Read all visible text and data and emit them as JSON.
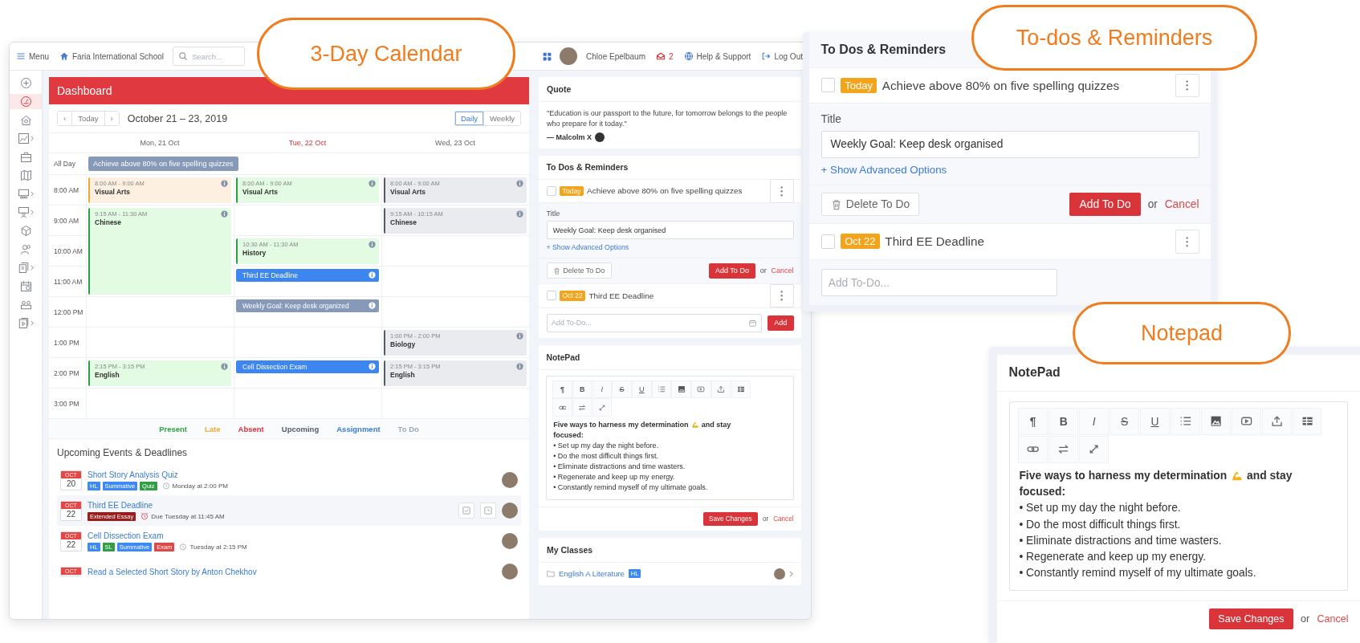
{
  "callouts": [
    {
      "label": "3-Day Calendar"
    },
    {
      "label": "To-dos & Reminders"
    },
    {
      "label": "Notepad"
    }
  ],
  "top_bar": {
    "menu": "Menu",
    "school": "Faria International School",
    "search_placeholder": "Search...",
    "user": "Chloe Epelbaum",
    "mail_count": "2",
    "help": "Help & Support",
    "logout": "Log Out"
  },
  "rail": [
    {
      "selected": false,
      "expandable": false
    },
    {
      "selected": true,
      "expandable": false
    },
    {
      "selected": false,
      "expandable": false
    },
    {
      "selected": false,
      "expandable": true
    },
    {
      "selected": false,
      "expandable": false
    },
    {
      "selected": false,
      "expandable": false
    },
    {
      "selected": false,
      "expandable": true
    },
    {
      "selected": false,
      "expandable": true
    },
    {
      "selected": false,
      "expandable": false
    },
    {
      "selected": false,
      "expandable": false
    },
    {
      "selected": false,
      "expandable": true
    },
    {
      "selected": false,
      "expandable": false
    },
    {
      "selected": false,
      "expandable": false
    },
    {
      "selected": false,
      "expandable": true
    }
  ],
  "dashboard": {
    "title": "Dashboard",
    "nav": {
      "prev": "‹",
      "today": "Today",
      "next": "›"
    },
    "range": "October 21 – 23, 2019",
    "views": [
      {
        "label": "Daily",
        "selected": true
      },
      {
        "label": "Weekly",
        "selected": false
      }
    ],
    "all_day_label": "All Day",
    "hours": [
      "8:00 AM",
      "9:00 AM",
      "10:00 AM",
      "11:00 AM",
      "12:00 PM",
      "1:00 PM",
      "2:00 PM",
      "3:00 PM"
    ],
    "days": [
      {
        "label": "Mon, 21 Oct",
        "today": false,
        "all_day": [
          {
            "title": "Achieve above 80% on five spelling quizzes"
          }
        ],
        "events": [
          {
            "time": "8:00 AM - 9:00 AM",
            "title": "Visual Arts",
            "kind": "late"
          },
          {
            "time": "9:15 AM - 11:30 AM",
            "title": "Chinese",
            "kind": "present"
          },
          {
            "time": "2:15 PM - 3:15 PM",
            "title": "English",
            "kind": "present"
          }
        ]
      },
      {
        "label": "Tue, 22 Oct",
        "today": true,
        "events": [
          {
            "time": "8:00 AM - 9:00 AM",
            "title": "Visual Arts",
            "kind": "present"
          },
          {
            "time": "10:30 AM - 11:30 AM",
            "title": "History",
            "kind": "present"
          },
          {
            "title": "Third EE Deadline",
            "kind": "assignment"
          },
          {
            "title": "Weekly Goal: Keep desk organized",
            "kind": "todo"
          },
          {
            "title": "Cell Dissection Exam",
            "kind": "assignment"
          }
        ]
      },
      {
        "label": "Wed, 23 Oct",
        "today": false,
        "events": [
          {
            "time": "8:00 AM - 9:00 AM",
            "title": "Visual Arts",
            "kind": "upcoming"
          },
          {
            "time": "9:15 AM - 10:15 AM",
            "title": "Chinese",
            "kind": "upcoming"
          },
          {
            "time": "1:00 PM - 2:00 PM",
            "title": "Biology",
            "kind": "upcoming"
          },
          {
            "time": "2:15 PM - 3:15 PM",
            "title": "English",
            "kind": "upcoming"
          }
        ]
      }
    ],
    "legend": [
      {
        "label": "Present",
        "color": "#2e9e44"
      },
      {
        "label": "Late",
        "color": "#f0a830"
      },
      {
        "label": "Absent",
        "color": "#d9303a"
      },
      {
        "label": "Upcoming",
        "color": "#555b66"
      },
      {
        "label": "Assignment",
        "color": "#3a7bd5"
      },
      {
        "label": "To Do",
        "color": "#9aa8bc"
      }
    ],
    "upcoming": {
      "title": "Upcoming Events & Deadlines",
      "items": [
        {
          "month": "OCT",
          "day": "20",
          "title": "Short Story Analysis Quiz",
          "tags": [
            {
              "label": "HL",
              "color": "#3d8af7"
            },
            {
              "label": "Summative",
              "color": "#3d8af7"
            },
            {
              "label": "Quiz",
              "color": "#2f9e44"
            }
          ],
          "when": "Monday at 2:00 PM",
          "due": false,
          "selected": false
        },
        {
          "month": "OCT",
          "day": "22",
          "title": "Third EE Deadline",
          "tags": [
            {
              "label": "Extended Essay",
              "color": "#9b1c1c"
            }
          ],
          "when": "Due Tuesday at 11:45 AM",
          "due": true,
          "selected": true
        },
        {
          "month": "OCT",
          "day": "22",
          "title": "Cell Dissection Exam",
          "tags": [
            {
              "label": "HL",
              "color": "#3d8af7"
            },
            {
              "label": "SL",
              "color": "#2f9e44"
            },
            {
              "label": "Summative",
              "color": "#3d8af7"
            },
            {
              "label": "Exam",
              "color": "#e04848"
            }
          ],
          "when": "Tuesday at 2:15 PM",
          "due": false,
          "selected": false
        },
        {
          "month": "OCT",
          "title": "Read a Selected Short Story by Anton Chekhov",
          "selected": false
        }
      ]
    }
  },
  "right": {
    "quote": {
      "title": "Quote",
      "text": "\"Education is our passport to the future, for tomorrow belongs to the people who prepare for it today.\"",
      "author": "— Malcolm X"
    },
    "todos": {
      "title": "To Dos & Reminders",
      "items": [
        {
          "kind": "todo",
          "checked": false,
          "tag": "Today",
          "text": "Achieve above 80% on five spelling quizzes"
        },
        {
          "kind": "form",
          "label": "Title",
          "value": "Weekly Goal: Keep desk organised",
          "advanced": "+ Show Advanced Options",
          "delete": "Delete To Do",
          "submit": "Add To Do",
          "or": "or",
          "cancel": "Cancel"
        },
        {
          "kind": "todo",
          "checked": false,
          "tag": "Oct 22",
          "text": "Third EE Deadline"
        }
      ],
      "add_placeholder": "Add To-Do...",
      "add_button": "Add"
    },
    "notepad": {
      "title": "NotePad",
      "toolbar": [
        {
          "kind": "para",
          "label": "¶"
        },
        {
          "kind": "bold",
          "label": "B"
        },
        {
          "kind": "italic",
          "label": "I"
        },
        {
          "kind": "strike",
          "label": "S"
        },
        {
          "kind": "underline",
          "label": "U"
        },
        {
          "kind": "list"
        },
        {
          "kind": "image"
        },
        {
          "kind": "video"
        },
        {
          "kind": "upload"
        },
        {
          "kind": "table"
        },
        {
          "kind": "link"
        },
        {
          "kind": "swap"
        },
        {
          "kind": "expand"
        }
      ],
      "heading_start": "Five ways to harness my determination",
      "heading_end": "and stay",
      "heading_tail": "focused:",
      "lines": [
        "• Set up my day the night before.",
        "• Do the most difficult things first.",
        "• Eliminate distractions and time wasters.",
        "• Regenerate and keep up my energy.",
        "• Constantly remind myself of my ultimate goals."
      ],
      "save": "Save Changes",
      "or": "or",
      "cancel": "Cancel"
    },
    "classes": {
      "title": "My Classes",
      "items": [
        {
          "name": "English A Literature",
          "badge": "HL"
        }
      ]
    }
  },
  "zoom_todos": {
    "title": "To Dos & Reminders",
    "items": [
      {
        "kind": "todo",
        "checked": false,
        "tag": "Today",
        "text": "Achieve above 80% on five spelling quizzes"
      },
      {
        "kind": "form",
        "label": "Title",
        "value": "Weekly Goal: Keep desk organised",
        "advanced": "+ Show Advanced Options",
        "delete": "Delete To Do",
        "submit": "Add To Do",
        "or": "or",
        "cancel": "Cancel"
      },
      {
        "kind": "todo",
        "checked": false,
        "tag": "Oct 22",
        "text": "Third EE Deadline"
      }
    ],
    "add_placeholder": "Add To-Do..."
  },
  "zoom_notepad": {
    "title": "NotePad",
    "toolbar": [
      {
        "kind": "para",
        "label": "¶"
      },
      {
        "kind": "bold",
        "label": "B"
      },
      {
        "kind": "italic",
        "label": "I"
      },
      {
        "kind": "strike",
        "label": "S"
      },
      {
        "kind": "underline",
        "label": "U"
      },
      {
        "kind": "list"
      },
      {
        "kind": "image"
      },
      {
        "kind": "video"
      },
      {
        "kind": "upload"
      },
      {
        "kind": "table"
      },
      {
        "kind": "link"
      },
      {
        "kind": "swap"
      },
      {
        "kind": "expand"
      }
    ],
    "heading_start": "Five ways to harness my determination",
    "heading_end": "and stay",
    "heading_tail": "focused:",
    "lines": [
      "• Set up my day the night before.",
      "• Do the most difficult things first.",
      "• Eliminate distractions and time wasters.",
      "• Regenerate and keep up my energy.",
      "• Constantly remind myself of my ultimate goals."
    ],
    "save": "Save Changes",
    "or": "or",
    "cancel": "Cancel"
  }
}
